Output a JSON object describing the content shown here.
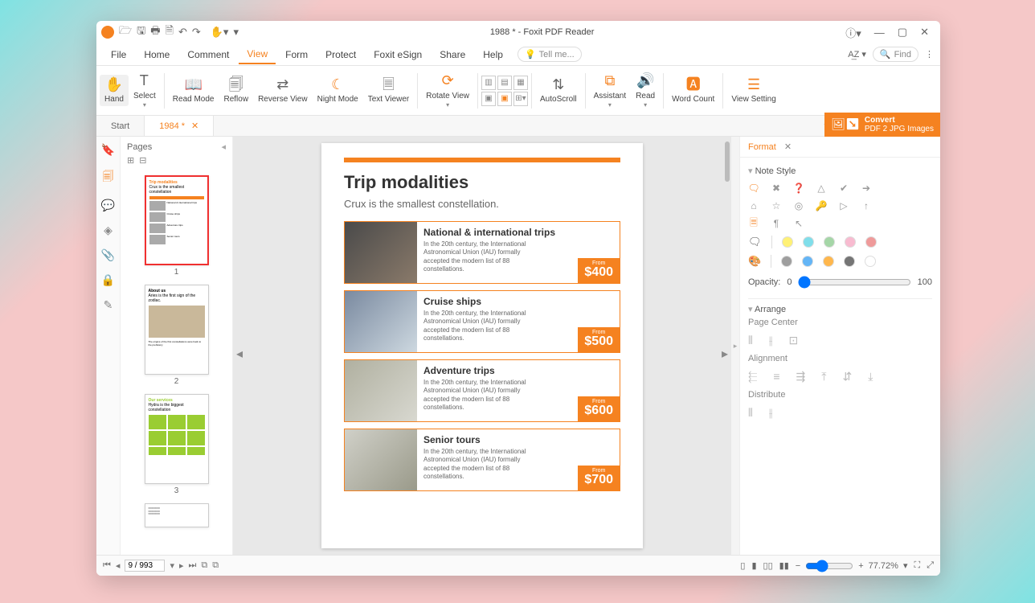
{
  "title": "1988 * - Foxit PDF Reader",
  "menus": [
    "File",
    "Home",
    "Comment",
    "View",
    "Form",
    "Protect",
    "Foxit eSign",
    "Share",
    "Help"
  ],
  "active_menu": "View",
  "tellme": "Tell me...",
  "find": "Find",
  "ribbon": {
    "hand": "Hand",
    "select": "Select",
    "read_mode": "Read Mode",
    "reflow": "Reflow",
    "reverse_view": "Reverse View",
    "night_mode": "Night Mode",
    "text_viewer": "Text Viewer",
    "rotate_view": "Rotate View",
    "autoscroll": "AutoScroll",
    "assistant": "Assistant",
    "read": "Read",
    "word_count": "Word Count",
    "view_setting": "View Setting"
  },
  "tabs": {
    "start": "Start",
    "doc": "1984 *"
  },
  "convert": {
    "l1": "Convert",
    "l2": "PDF 2 JPG Images"
  },
  "thumbs": {
    "hdr": "Pages",
    "p1": "1",
    "p2": "2",
    "p3": "3"
  },
  "doc": {
    "heading": "Trip modalities",
    "sub": "Crux is the smallest constellation.",
    "body": "In the 20th century, the International Astronomical Union (IAU) formally accepted the modern list of 88 constellations.",
    "from": "From",
    "items": [
      {
        "t": "National & international trips",
        "p": "$400"
      },
      {
        "t": "Cruise ships",
        "p": "$500"
      },
      {
        "t": "Adventure trips",
        "p": "$600"
      },
      {
        "t": "Senior tours",
        "p": "$700"
      }
    ]
  },
  "format": {
    "tab": "Format",
    "note_style": "Note Style",
    "arrange": "Arrange",
    "page_center": "Page Center",
    "alignment": "Alignment",
    "distribute": "Distribute",
    "opacity_lbl": "Opacity:",
    "opacity_min": "0",
    "opacity_max": "100",
    "colors1": [
      "#FFF176",
      "#80DEEA",
      "#A5D6A7",
      "#F8BBD0",
      "#EF9A9A"
    ],
    "colors2": [
      "#9E9E9E",
      "#64B5F6",
      "#FFB74D",
      "#757575",
      "#FFFFFF"
    ]
  },
  "status": {
    "page": "9 / 993",
    "zoom": "77.72%"
  }
}
